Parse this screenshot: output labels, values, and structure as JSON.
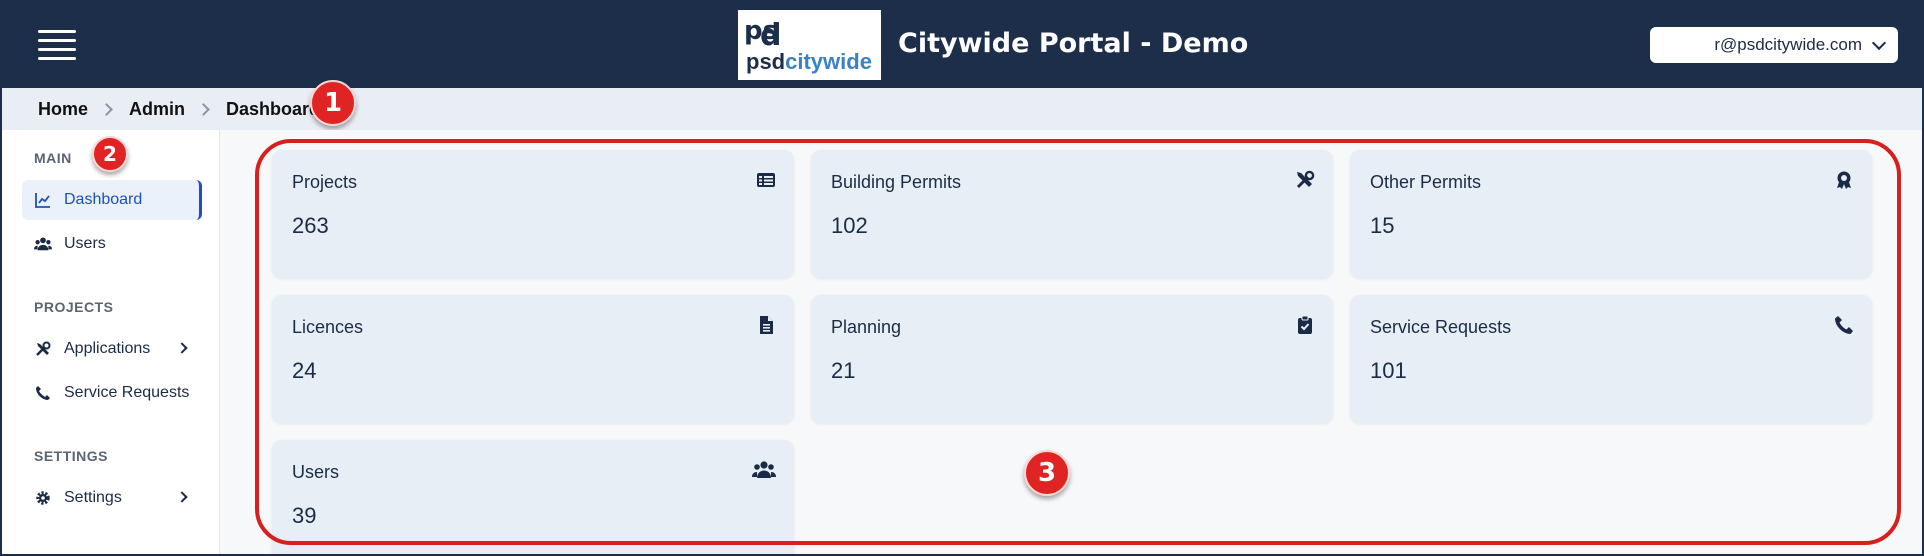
{
  "header": {
    "app_title": "Citywide Portal - Demo",
    "logo_mark": "psd",
    "logo_brand_1": "psd",
    "logo_brand_2": "citywide",
    "user_email": "r@psdcitywide.com"
  },
  "breadcrumb": {
    "items": [
      "Home",
      "Admin",
      "Dashboard"
    ]
  },
  "annotations": {
    "badge_1": "1",
    "badge_2": "2",
    "badge_3": "3"
  },
  "sidebar": {
    "sections": [
      {
        "label": "MAIN"
      },
      {
        "label": "PROJECTS"
      },
      {
        "label": "SETTINGS"
      }
    ],
    "items": [
      {
        "label": "Dashboard",
        "icon": "chart-line-icon",
        "active": true
      },
      {
        "label": "Users",
        "icon": "users-icon"
      },
      {
        "label": "Applications",
        "icon": "tools-icon",
        "expandable": true
      },
      {
        "label": "Service Requests",
        "icon": "phone-icon"
      },
      {
        "label": "Settings",
        "icon": "gear-icon",
        "expandable": true
      }
    ]
  },
  "cards": [
    {
      "label": "Projects",
      "value": "263",
      "icon": "table-list-icon"
    },
    {
      "label": "Building Permits",
      "value": "102",
      "icon": "tools-icon"
    },
    {
      "label": "Other Permits",
      "value": "15",
      "icon": "award-icon"
    },
    {
      "label": "Licences",
      "value": "24",
      "icon": "document-icon"
    },
    {
      "label": "Planning",
      "value": "21",
      "icon": "clipboard-check-icon"
    },
    {
      "label": "Service Requests",
      "value": "101",
      "icon": "phone-icon"
    },
    {
      "label": "Users",
      "value": "39",
      "icon": "users-icon"
    }
  ],
  "colors": {
    "header_bg": "#1c2e4a",
    "accent": "#1f4fbf",
    "annotation_red": "#e02424",
    "card_bg": "#e7eef5"
  }
}
